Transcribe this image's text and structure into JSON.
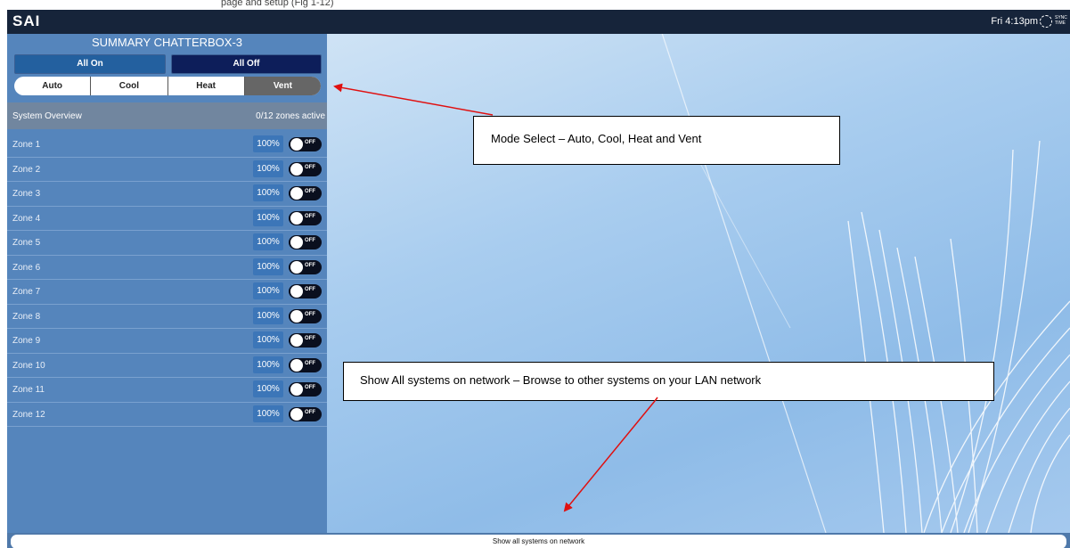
{
  "page_caption": "page and setup (Fig 1-12)",
  "app": {
    "logo": "SAI",
    "clock": "Fri 4:13pm",
    "sync_label": "SYNC TIME"
  },
  "panel": {
    "title": "SUMMARY CHATTERBOX-3",
    "all_on": "All On",
    "all_off": "All Off",
    "modes": [
      "Auto",
      "Cool",
      "Heat",
      "Vent"
    ],
    "active_mode": "Vent",
    "overview_label": "System Overview",
    "overview_count": "0/12 zones active",
    "zones": [
      {
        "name": "Zone 1",
        "percent": "100%",
        "state": "OFF"
      },
      {
        "name": "Zone 2",
        "percent": "100%",
        "state": "OFF"
      },
      {
        "name": "Zone 3",
        "percent": "100%",
        "state": "OFF"
      },
      {
        "name": "Zone 4",
        "percent": "100%",
        "state": "OFF"
      },
      {
        "name": "Zone 5",
        "percent": "100%",
        "state": "OFF"
      },
      {
        "name": "Zone 6",
        "percent": "100%",
        "state": "OFF"
      },
      {
        "name": "Zone 7",
        "percent": "100%",
        "state": "OFF"
      },
      {
        "name": "Zone 8",
        "percent": "100%",
        "state": "OFF"
      },
      {
        "name": "Zone 9",
        "percent": "100%",
        "state": "OFF"
      },
      {
        "name": "Zone 10",
        "percent": "100%",
        "state": "OFF"
      },
      {
        "name": "Zone 11",
        "percent": "100%",
        "state": "OFF"
      },
      {
        "name": "Zone 12",
        "percent": "100%",
        "state": "OFF"
      }
    ]
  },
  "bottom": {
    "show_all": "Show all systems on network"
  },
  "annotations": {
    "mode_select": "Mode Select – Auto, Cool, Heat and Vent",
    "show_all_systems": "Show All systems on network – Browse to other systems on your LAN network"
  },
  "colors": {
    "topbar": "#16243a",
    "panel": "#5585bc",
    "arrow": "#e01010",
    "active_mode": "#666666"
  }
}
